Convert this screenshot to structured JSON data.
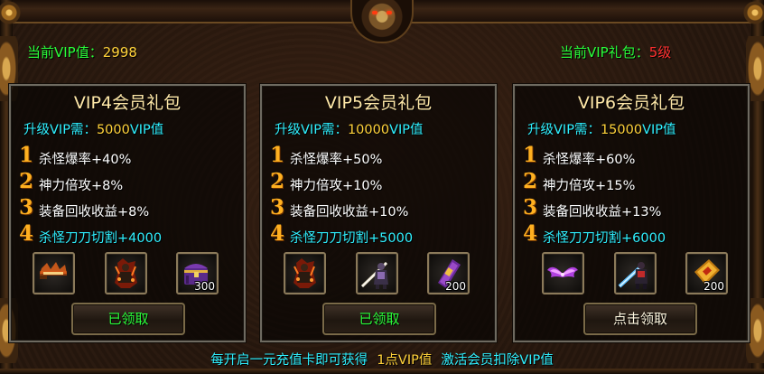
{
  "header": {
    "current_vip_label": "当前VIP值：",
    "current_vip_value": "2998",
    "current_pack_label": "当前VIP礼包：",
    "current_pack_level": "5级"
  },
  "packs": [
    {
      "title": "VIP4会员礼包",
      "req_label": "升级VIP需：",
      "req_value": "5000",
      "req_unit": "VIP值",
      "perks": [
        {
          "num": "1",
          "text": "杀怪爆率+40%"
        },
        {
          "num": "2",
          "text": "神力倍攻+8%"
        },
        {
          "num": "3",
          "text": "装备回收收益+8%"
        },
        {
          "num": "4",
          "text": "杀怪刀刀切割+4000"
        }
      ],
      "items": [
        {
          "icon": "flame-sword-icon",
          "count": ""
        },
        {
          "icon": "flame-warrior-icon",
          "count": ""
        },
        {
          "icon": "purple-chest-icon",
          "count": "300"
        }
      ],
      "button": "已领取"
    },
    {
      "title": "VIP5会员礼包",
      "req_label": "升级VIP需：",
      "req_value": "10000",
      "req_unit": "VIP值",
      "perks": [
        {
          "num": "1",
          "text": "杀怪爆率+50%"
        },
        {
          "num": "2",
          "text": "神力倍攻+10%"
        },
        {
          "num": "3",
          "text": "装备回收收益+10%"
        },
        {
          "num": "4",
          "text": "杀怪刀刀切割+5000"
        }
      ],
      "items": [
        {
          "icon": "flame-warrior-icon",
          "count": ""
        },
        {
          "icon": "armored-swordsman-icon",
          "count": ""
        },
        {
          "icon": "purple-scroll-icon",
          "count": "200"
        }
      ],
      "button": "已领取"
    },
    {
      "title": "VIP6会员礼包",
      "req_label": "升级VIP需：",
      "req_value": "15000",
      "req_unit": "VIP值",
      "perks": [
        {
          "num": "1",
          "text": "杀怪爆率+60%"
        },
        {
          "num": "2",
          "text": "神力倍攻+15%"
        },
        {
          "num": "3",
          "text": "装备回收收益+13%"
        },
        {
          "num": "4",
          "text": "杀怪刀刀切割+6000"
        }
      ],
      "items": [
        {
          "icon": "purple-wings-icon",
          "count": ""
        },
        {
          "icon": "ice-swordsman-icon",
          "count": ""
        },
        {
          "icon": "gold-scroll-icon",
          "count": "200"
        }
      ],
      "button": "点击领取"
    }
  ],
  "footer": {
    "part1": "每开启一元充值卡即可获得",
    "part2": "1点VIP值",
    "part3": "激活会员扣除VIP值"
  },
  "colors": {
    "green": "#2aff3a",
    "cyan": "#2ff0ff",
    "gold": "#ffd23a",
    "red": "#ff3030",
    "perk_number": "#ffb020"
  }
}
